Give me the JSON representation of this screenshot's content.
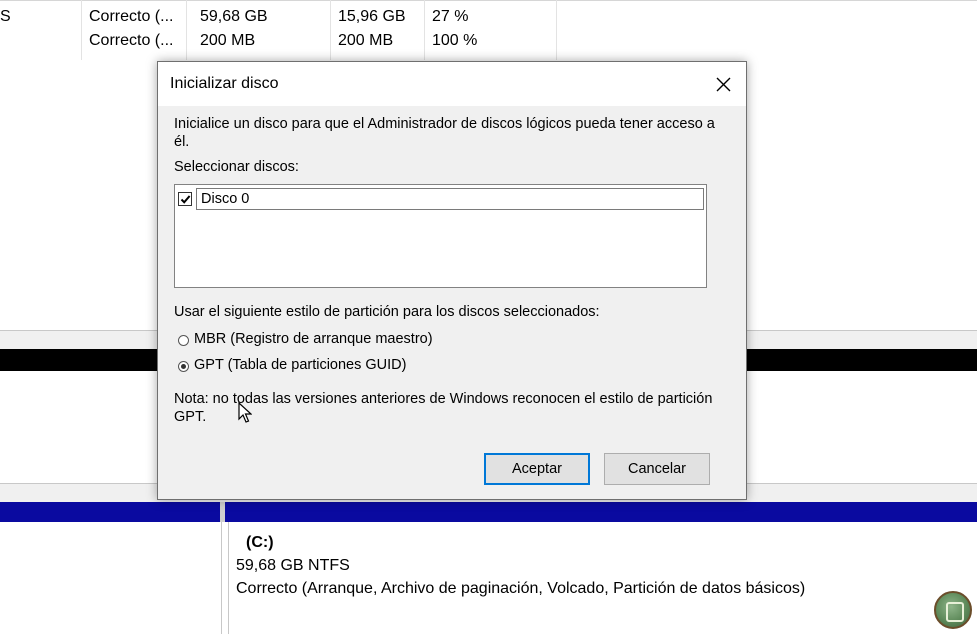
{
  "volume_list": {
    "rows": [
      {
        "col0": "S",
        "status": "Correcto (...",
        "capacity": "59,68 GB",
        "free": "15,96 GB",
        "pct_free": "27 %"
      },
      {
        "col0": "",
        "status": "Correcto (...",
        "capacity": "200 MB",
        "free": "200 MB",
        "pct_free": "100 %"
      }
    ]
  },
  "disk_map": {
    "partition": {
      "name": "(C:)",
      "size": "59,68 GB NTFS",
      "status": "Correcto (Arranque, Archivo de paginación, Volcado, Partición de datos básicos)"
    }
  },
  "dialog": {
    "title": "Inicializar disco",
    "intro": "Inicialice un disco para que el Administrador de discos lógicos pueda tener acceso a él.",
    "select_label": "Seleccionar discos:",
    "disks": [
      {
        "label": "Disco 0",
        "checked": true
      }
    ],
    "style_label": "Usar el siguiente estilo de partición para los discos seleccionados:",
    "options": [
      {
        "label": "MBR (Registro de arranque maestro)",
        "selected": false
      },
      {
        "label": "GPT (Tabla de particiones GUID)",
        "selected": true
      }
    ],
    "note": "Nota: no todas las versiones anteriores de Windows reconocen el estilo de partición GPT.",
    "ok_label": "Aceptar",
    "cancel_label": "Cancelar"
  },
  "colors": {
    "accent": "#0078d7",
    "partition_bar": "#0a0aa0",
    "unallocated_bar": "#000000"
  }
}
